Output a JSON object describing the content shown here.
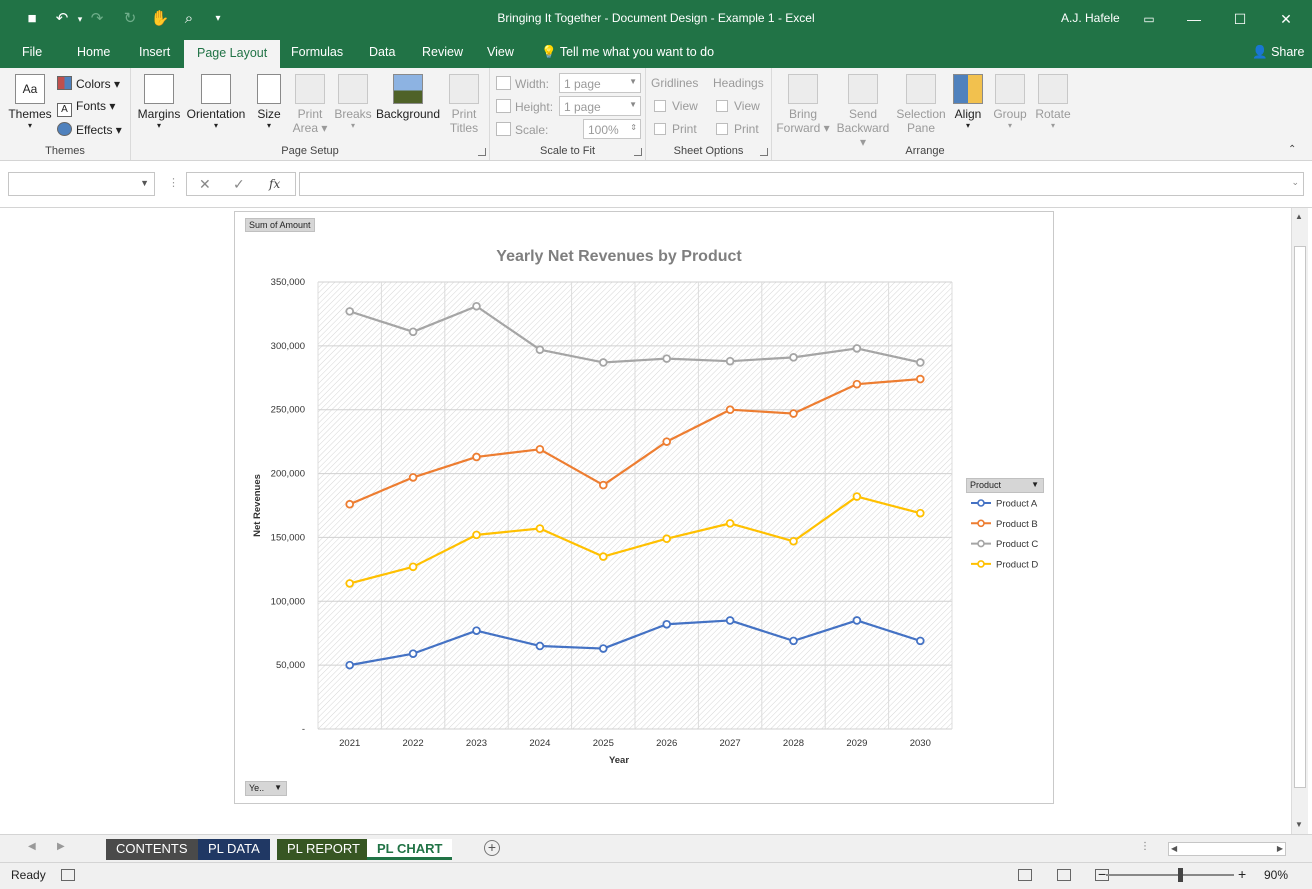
{
  "window": {
    "title": "Bringing It Together - Document Design - Example 1  -  Excel",
    "user": "A.J. Hafele",
    "share_label": "Share",
    "accent": "#217346"
  },
  "qat": [
    {
      "icon": "save-icon",
      "glyph": "💾"
    },
    {
      "icon": "undo-icon",
      "glyph": "↶"
    },
    {
      "icon": "redo-icon",
      "glyph": "↷"
    },
    {
      "icon": "refresh-icon",
      "glyph": "↻"
    },
    {
      "icon": "touch-mode-icon",
      "glyph": "✋"
    },
    {
      "icon": "print-preview-icon",
      "glyph": "🔍"
    },
    {
      "icon": "customize-qat-icon",
      "glyph": "▾"
    }
  ],
  "tabs": [
    {
      "id": "file",
      "label": "File"
    },
    {
      "id": "home",
      "label": "Home"
    },
    {
      "id": "insert",
      "label": "Insert"
    },
    {
      "id": "page-layout",
      "label": "Page Layout"
    },
    {
      "id": "formulas",
      "label": "Formulas"
    },
    {
      "id": "data",
      "label": "Data"
    },
    {
      "id": "review",
      "label": "Review"
    },
    {
      "id": "view",
      "label": "View"
    }
  ],
  "tell_me": "Tell me what you want to do",
  "ribbon": {
    "themes": {
      "group": "Themes",
      "themes": "Themes",
      "colors": "Colors",
      "fonts": "Fonts",
      "effects": "Effects"
    },
    "page_setup": {
      "group": "Page Setup",
      "margins": "Margins",
      "orientation": "Orientation",
      "size": "Size",
      "print_area_1": "Print",
      "print_area_2": "Area",
      "breaks": "Breaks",
      "background": "Background",
      "print_titles_1": "Print",
      "print_titles_2": "Titles"
    },
    "scale": {
      "group": "Scale to Fit",
      "width_label": "Width:",
      "width_value": "1 page",
      "height_label": "Height:",
      "height_value": "1 page",
      "scale_label": "Scale:",
      "scale_value": "100%"
    },
    "sheet_options": {
      "group": "Sheet Options",
      "gridlines": "Gridlines",
      "headings": "Headings",
      "view": "View",
      "print": "Print"
    },
    "arrange": {
      "group": "Arrange",
      "bring_1": "Bring",
      "bring_2": "Forward",
      "send_1": "Send",
      "send_2": "Backward",
      "sel_1": "Selection",
      "sel_2": "Pane",
      "align": "Align",
      "group_btn": "Group",
      "rotate": "Rotate"
    }
  },
  "formula_bar": {
    "name_box": "",
    "formula": "",
    "cancel": "✕",
    "enter": "✓",
    "fx": "fx"
  },
  "pivot": {
    "values_button": "Sum of Amount",
    "axis_button": "Ye..",
    "legend_button": "Product"
  },
  "chart_data": {
    "type": "line",
    "title": "Yearly Net Revenues by Product",
    "xlabel": "Year",
    "ylabel": "Net Revenues",
    "x": [
      "2021",
      "2022",
      "2023",
      "2024",
      "2025",
      "2026",
      "2027",
      "2028",
      "2029",
      "2030"
    ],
    "ylim": [
      0,
      350000
    ],
    "yticks": [
      0,
      50000,
      100000,
      150000,
      200000,
      250000,
      300000,
      350000
    ],
    "ytick_labels": [
      "-",
      "50,000",
      "100,000",
      "150,000",
      "200,000",
      "250,000",
      "300,000",
      "350,000"
    ],
    "grid": true,
    "legend_position": "right",
    "series": [
      {
        "name": "Product A",
        "color": "#4472c4",
        "values": [
          50000,
          59000,
          77000,
          65000,
          63000,
          82000,
          85000,
          69000,
          85000,
          69000
        ]
      },
      {
        "name": "Product B",
        "color": "#ed7d31",
        "values": [
          176000,
          197000,
          213000,
          219000,
          191000,
          225000,
          250000,
          247000,
          270000,
          274000
        ]
      },
      {
        "name": "Product C",
        "color": "#a5a5a5",
        "values": [
          327000,
          311000,
          331000,
          297000,
          287000,
          290000,
          288000,
          291000,
          298000,
          287000
        ]
      },
      {
        "name": "Product D",
        "color": "#ffc000",
        "values": [
          114000,
          127000,
          152000,
          157000,
          135000,
          149000,
          161000,
          147000,
          182000,
          169000
        ]
      }
    ]
  },
  "sheets": [
    {
      "label": "CONTENTS",
      "color": "#4a4a4a"
    },
    {
      "label": "PL DATA",
      "color": "#203864"
    },
    {
      "label": "PL REPORT",
      "color": "#375623"
    },
    {
      "label": "PL CHART",
      "color": "#ffffff",
      "active": true
    }
  ],
  "status": {
    "ready": "Ready",
    "zoom": "90%"
  }
}
